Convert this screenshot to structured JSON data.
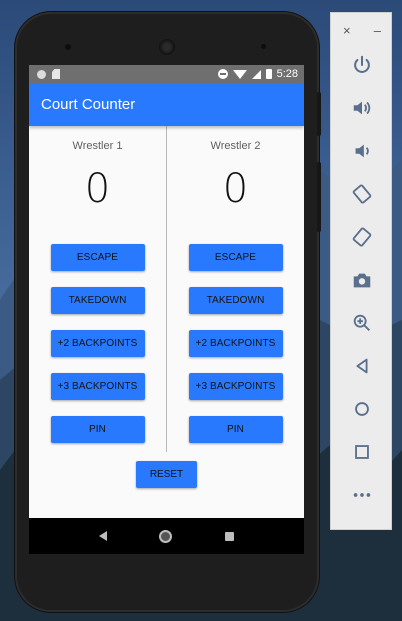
{
  "status_bar": {
    "time": "5:28"
  },
  "app": {
    "title": "Court Counter",
    "wrestler1": {
      "name": "Wrestler 1",
      "score": "0",
      "buttons": [
        "ESCAPE",
        "TAKEDOWN",
        "+2 BACKPOINTS",
        "+3 BACKPOINTS",
        "PIN"
      ]
    },
    "wrestler2": {
      "name": "Wrestler 2",
      "score": "0",
      "buttons": [
        "ESCAPE",
        "TAKEDOWN",
        "+2 BACKPOINTS",
        "+3 BACKPOINTS",
        "PIN"
      ]
    },
    "reset_label": "RESET"
  },
  "colors": {
    "accent": "#2979ff",
    "status_bar": "#6f6f6f",
    "toolbar_icon": "#5a6f8c"
  },
  "emulator_toolbar": {
    "close_glyph": "×",
    "minimize_glyph": "–",
    "icons": [
      "power-icon",
      "volume-up-icon",
      "volume-down-icon",
      "rotate-left-icon",
      "rotate-right-icon",
      "camera-icon",
      "zoom-icon",
      "back-icon",
      "home-icon",
      "overview-icon",
      "more-icon"
    ]
  }
}
